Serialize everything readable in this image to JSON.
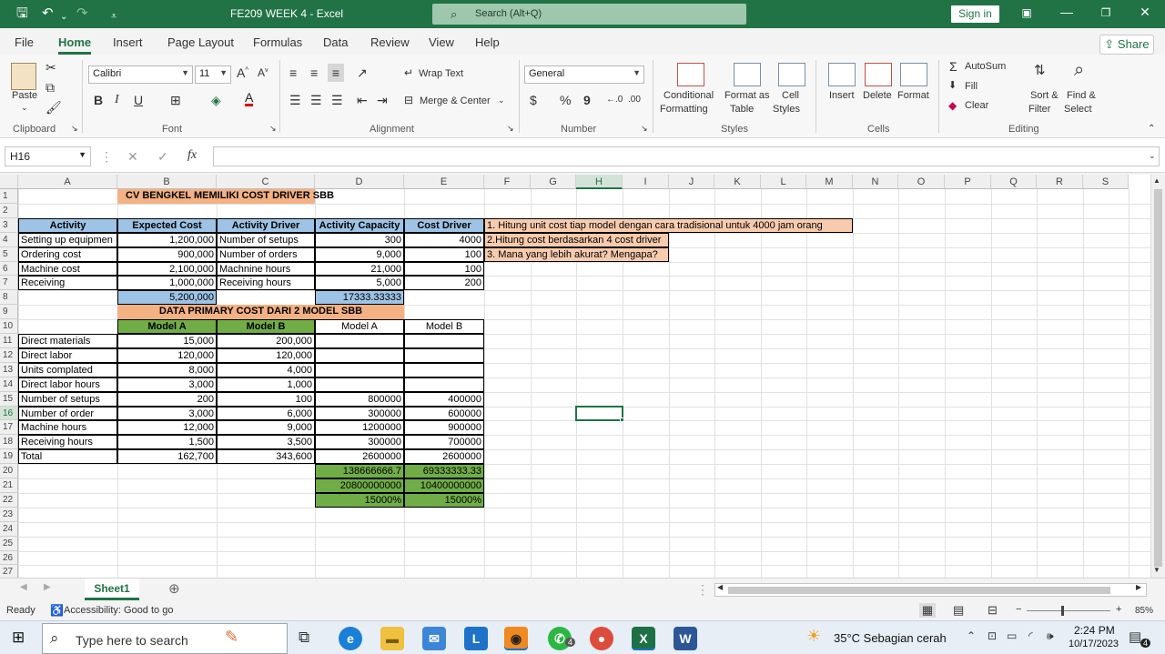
{
  "titlebar": {
    "title": "FE209 WEEK 4  -  Excel",
    "search_placeholder": "Search (Alt+Q)",
    "signin_label": "Sign in"
  },
  "menu": {
    "tabs": [
      "File",
      "Home",
      "Insert",
      "Page Layout",
      "Formulas",
      "Data",
      "Review",
      "View",
      "Help"
    ],
    "share_label": "Share"
  },
  "ribbon": {
    "clipboard": {
      "paste": "Paste",
      "group": "Clipboard"
    },
    "font": {
      "name": "Calibri",
      "size": "11",
      "group": "Font"
    },
    "alignment": {
      "wrap": "Wrap Text",
      "merge": "Merge & Center",
      "group": "Alignment"
    },
    "number": {
      "format": "General",
      "group": "Number"
    },
    "styles": {
      "conditional": "Conditional",
      "conditional2": "Formatting",
      "format_as": "Format as",
      "format_as2": "Table",
      "cell": "Cell",
      "cell2": "Styles",
      "group": "Styles"
    },
    "cells": {
      "insert": "Insert",
      "delete": "Delete",
      "format": "Format",
      "group": "Cells"
    },
    "editing": {
      "autosum": "AutoSum",
      "fill": "Fill",
      "clear": "Clear",
      "sort": "Sort &",
      "sort2": "Filter",
      "find": "Find &",
      "find2": "Select",
      "group": "Editing"
    }
  },
  "formula": {
    "namebox": "H16",
    "value": ""
  },
  "columns": [
    "A",
    "B",
    "C",
    "D",
    "E",
    "F",
    "G",
    "H",
    "I",
    "J",
    "K",
    "L",
    "M",
    "N",
    "O",
    "P",
    "Q",
    "R",
    "S"
  ],
  "rows": [
    "1",
    "2",
    "3",
    "4",
    "5",
    "6",
    "7",
    "8",
    "9",
    "10",
    "11",
    "12",
    "13",
    "14",
    "15",
    "16",
    "17",
    "18",
    "19",
    "20",
    "21",
    "22",
    "23",
    "24",
    "25",
    "26",
    "27"
  ],
  "sheet": {
    "title1": "CV BENGKEL MEMILIKI COST DRIVER SBB",
    "hdr": {
      "activity": "Activity",
      "expected": "Expected Cost",
      "driver": "Activity Driver",
      "capacity": "Activity Capacity",
      "costdriver": "Cost Driver"
    },
    "activities": [
      {
        "name": "Setting up equipmen",
        "cost": "1,200,000",
        "driver": "Number of setups",
        "cap": "300",
        "cd": "4000"
      },
      {
        "name": "Ordering cost",
        "cost": "900,000",
        "driver": "Number of orders",
        "cap": "9,000",
        "cd": "100"
      },
      {
        "name": "Machine cost",
        "cost": "2,100,000",
        "driver": "Machnine hours",
        "cap": "21,000",
        "cd": "100"
      },
      {
        "name": "Receiving",
        "cost": "1,000,000",
        "driver": "Receiving hours",
        "cap": "5,000",
        "cd": "200"
      }
    ],
    "total_cost": "5,200,000",
    "total_cap": "17333.33333",
    "notes": [
      "1. Hitung unit cost tiap model dengan cara tradisional untuk 4000 jam orang",
      "2.Hitung cost berdasarkan 4 cost driver",
      "3. Mana yang lebih akurat? Mengapa?"
    ],
    "title2": "DATA PRIMARY COST DARI 2 MODEL SBB",
    "modelA": "Model A",
    "modelB": "Model B",
    "primary": [
      {
        "name": "Direct materials",
        "a": "15,000",
        "b": "200,000",
        "d": "",
        "e": ""
      },
      {
        "name": "Direct labor",
        "a": "120,000",
        "b": "120,000",
        "d": "",
        "e": ""
      },
      {
        "name": "Units complated",
        "a": "8,000",
        "b": "4,000",
        "d": "",
        "e": ""
      },
      {
        "name": "Direct labor hours",
        "a": "3,000",
        "b": "1,000",
        "d": "",
        "e": ""
      },
      {
        "name": "Number of setups",
        "a": "200",
        "b": "100",
        "d": "800000",
        "e": "400000"
      },
      {
        "name": "Number of order",
        "a": "3,000",
        "b": "6,000",
        "d": "300000",
        "e": "600000"
      },
      {
        "name": "Machine hours",
        "a": "12,000",
        "b": "9,000",
        "d": "1200000",
        "e": "900000"
      },
      {
        "name": "Receiving hours",
        "a": "1,500",
        "b": "3,500",
        "d": "300000",
        "e": "700000"
      },
      {
        "name": "Total",
        "a": "162,700",
        "b": "343,600",
        "d": "2600000",
        "e": "2600000"
      }
    ],
    "extra": [
      {
        "d": "138666666.7",
        "e": "69333333.33"
      },
      {
        "d": "20800000000",
        "e": "10400000000"
      },
      {
        "d": "15000%",
        "e": "15000%"
      }
    ]
  },
  "sheettab": "Sheet1",
  "status": {
    "ready": "Ready",
    "accessibility": "Accessibility: Good to go",
    "zoom": "85%"
  },
  "taskbar": {
    "search": "Type here to search",
    "weather": "35°C  Sebagian cerah",
    "time": "2:24 PM",
    "date": "10/17/2023",
    "whatsapp_badge": "4",
    "notif_badge": "4"
  }
}
